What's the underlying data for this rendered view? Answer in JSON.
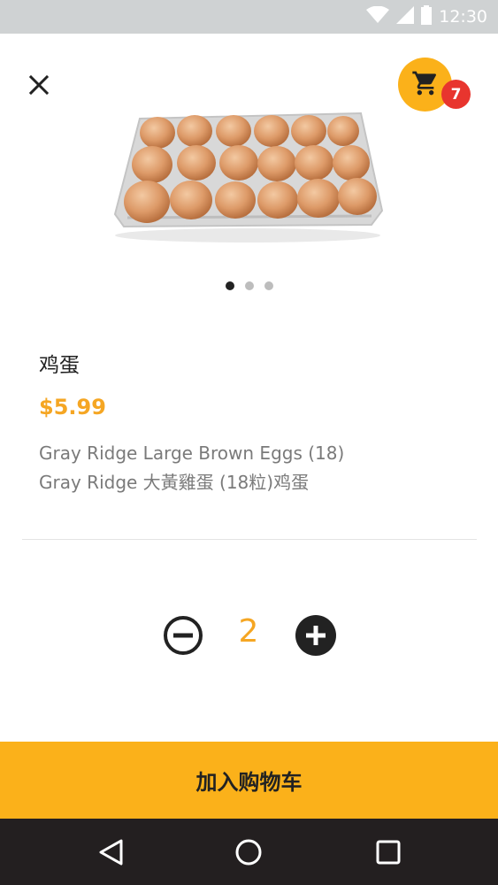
{
  "status_bar": {
    "time": "12:30",
    "icons": [
      "wifi-icon",
      "signal-icon",
      "battery-icon"
    ]
  },
  "header": {
    "close_icon": "close-icon",
    "cart_icon": "cart-icon",
    "cart_count": "7"
  },
  "carousel": {
    "pages": 3,
    "active_index": 0
  },
  "product": {
    "name": "鸡蛋",
    "price": "$5.99",
    "description_line1": "Gray Ridge Large Brown Eggs (18)",
    "description_line2": "Gray Ridge 大黃雞蛋 (18粒)鸡蛋"
  },
  "quantity": {
    "value": "2",
    "decrement_icon": "minus-circle-icon",
    "increment_icon": "plus-circle-icon"
  },
  "actions": {
    "add_to_cart_label": "加入购物车"
  },
  "nav": {
    "back_icon": "back-icon",
    "home_icon": "home-icon",
    "recents_icon": "recents-icon"
  },
  "colors": {
    "accent": "#fbb11a",
    "price": "#f5a623",
    "badge": "#e8352e",
    "status_bar": "#cfd2d3",
    "nav_bar": "#231f20"
  }
}
